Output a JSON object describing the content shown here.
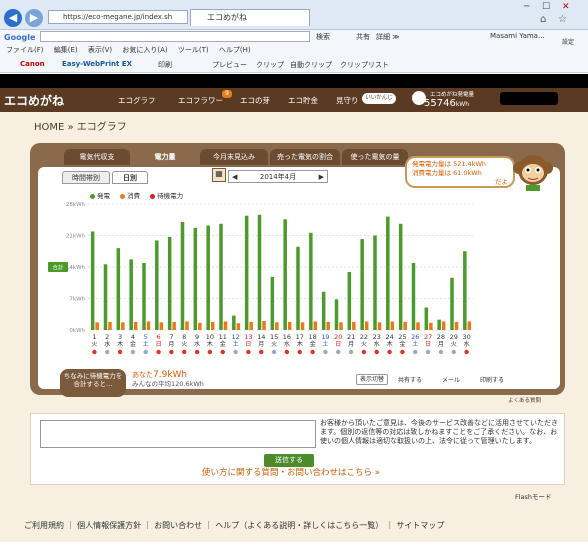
{
  "browser": {
    "address": "https://eco-megane.jp/index.sh",
    "tab_title": "エコめがね",
    "menu": [
      "ファイル(F)",
      "編集(E)",
      "表示(V)",
      "お気に入り(A)",
      "ツール(T)",
      "ヘルプ(H)"
    ],
    "google_label": "Google",
    "search_label": "検索",
    "share_label": "共有",
    "detail_label": "詳細 ≫",
    "user_label": "Masami Yama...",
    "settings_label": "設定",
    "canon_label": "Canon",
    "easy_label": "Easy-WebPrint EX",
    "print_label": "印刷",
    "preview_label": "プレビュー",
    "clip_label": "クリップ",
    "auto_clip_label": "自動クリップ",
    "clip_list_label": "クリップリスト"
  },
  "site": {
    "logo": "エコめがね",
    "nav": [
      "エコグラフ",
      "エコフラワー",
      "エコの芽",
      "エコ貯金",
      "見守り"
    ],
    "badge": "9",
    "status_label": "いいかんじ",
    "gen_label": "エコめがね発電量",
    "gen_value": "55746",
    "gen_unit": "kWh"
  },
  "breadcrumb": "HOME » エコグラフ",
  "tabs": [
    "電気代収支",
    "電力量",
    "今月末見込み",
    "売った電気の割合",
    "使った電気の量"
  ],
  "subtabs": [
    "時間帯別",
    "日別"
  ],
  "month": "2014年4月",
  "speech": {
    "line1": "発電電力量は 521.4kWh",
    "line2": "消費電力量は 61.0kWh",
    "line3": "だよ"
  },
  "legend": [
    "発電",
    "消費",
    "待機電力"
  ],
  "chart_data": {
    "type": "bar",
    "ylim": [
      0,
      28
    ],
    "yticks": [
      "0kWh",
      "7kWh",
      "14kWh",
      "21kWh",
      "28kWh"
    ],
    "side_label": "合計",
    "categories": [
      "1",
      "2",
      "3",
      "4",
      "5",
      "6",
      "7",
      "8",
      "9",
      "10",
      "11",
      "12",
      "13",
      "14",
      "15",
      "16",
      "17",
      "18",
      "19",
      "20",
      "21",
      "22",
      "23",
      "24",
      "25",
      "26",
      "27",
      "28",
      "29",
      "30"
    ],
    "weekdays": [
      "火",
      "水",
      "木",
      "金",
      "土",
      "日",
      "月",
      "火",
      "水",
      "木",
      "金",
      "土",
      "日",
      "月",
      "火",
      "水",
      "木",
      "金",
      "土",
      "日",
      "月",
      "火",
      "水",
      "木",
      "金",
      "土",
      "日",
      "月",
      "火",
      "水"
    ],
    "series": [
      {
        "name": "発電",
        "color": "#4c9a2a",
        "values": [
          21.9,
          14.6,
          18.2,
          15.7,
          14.9,
          19.9,
          20.7,
          24.0,
          22.7,
          23.2,
          23.6,
          3.2,
          25.4,
          25.6,
          11.8,
          24.6,
          18.5,
          21.6,
          8.5,
          6.8,
          12.9,
          20.2,
          21.0,
          25.2,
          23.6,
          14.9,
          5.0,
          2.3,
          11.6,
          17.5
        ]
      },
      {
        "name": "消費",
        "color": "#e87a1a",
        "values": [
          1.7,
          1.8,
          1.7,
          1.8,
          1.9,
          1.7,
          1.8,
          1.9,
          1.6,
          1.8,
          1.9,
          1.5,
          1.8,
          2.0,
          1.7,
          1.8,
          1.7,
          1.9,
          1.8,
          1.7,
          1.8,
          1.9,
          1.7,
          1.9,
          1.8,
          1.7,
          1.6,
          1.9,
          1.8,
          1.9
        ]
      },
      {
        "name": "待機電力",
        "color": "#d82020",
        "values": []
      }
    ]
  },
  "footnote": "ちなみに待機電力を合計すると…",
  "your_label": "あなた",
  "your_value": "7.9kWh",
  "avg_label": "みんなの平均",
  "avg_value": "120.6kWh",
  "display_switch": "表示切替",
  "share_btn": "共有する",
  "mail_btn": "メール",
  "print_btn": "印刷する",
  "faq_link": "よくある質問",
  "feedback": {
    "text": "お客様から頂いたご意見は、今後のサービス改善などに活用させていただきます。個別の返信等の対応は致しかねますことをご了承ください。なお、お使いの個人情報は適切な取扱いの上、法令に従って管理いたします。",
    "send": "送信する",
    "help_link": "使い方に関する質問・お問い合わせはこちら »"
  },
  "flash_mode": "Flashモード",
  "footer": [
    "ご利用規約",
    "個人情報保護方針",
    "お問い合わせ",
    "ヘルプ（よくある説明・詳しくはこちら一覧）",
    "サイトマップ"
  ]
}
